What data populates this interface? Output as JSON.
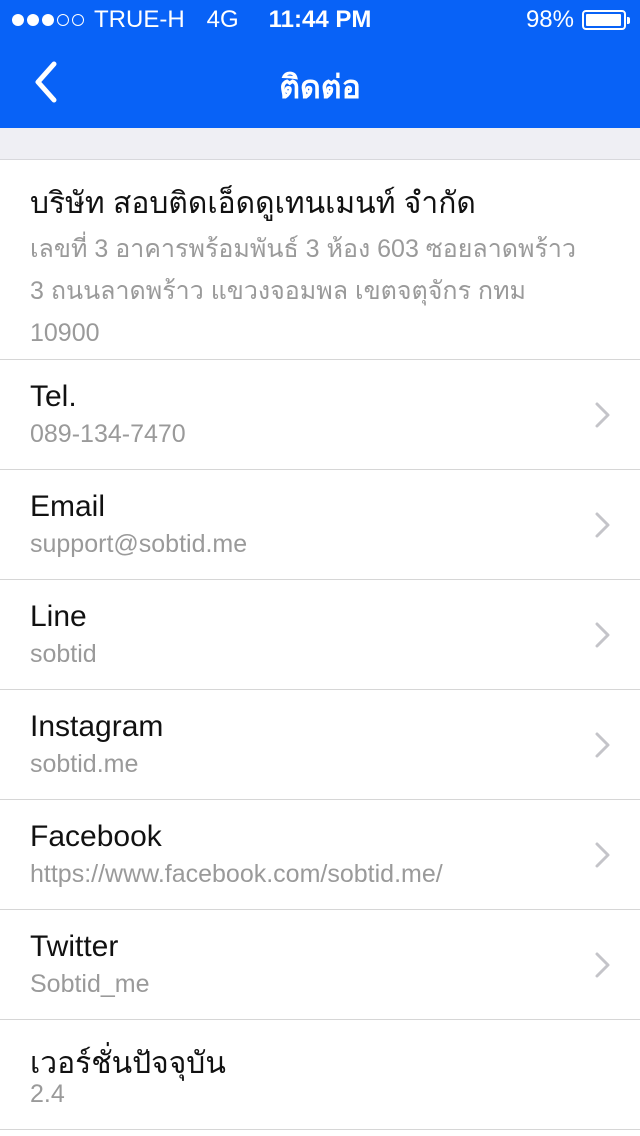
{
  "status_bar": {
    "carrier": "TRUE-H",
    "network": "4G",
    "time": "11:44 PM",
    "battery_text": "98%",
    "battery_level": 0.98,
    "signal_bars_filled": 3,
    "signal_bars_total": 5
  },
  "nav": {
    "title": "ติดต่อ",
    "back_icon": "chevron-left-icon",
    "bar_color": "#0862f7"
  },
  "company": {
    "name": "บริษัท สอบติดเอ็ดดูเทนเมนท์ จำกัด",
    "address": "เลขที่ 3 อาคารพร้อมพันธ์ 3 ห้อง 603 ซอยลาดพร้าว 3 ถนนลาดพร้าว แขวงจอมพล เขตจตุจักร กทม 10900"
  },
  "contacts": [
    {
      "label": "Tel.",
      "value": "089-134-7470",
      "icon": "chevron-right-icon"
    },
    {
      "label": "Email",
      "value": "support@sobtid.me",
      "icon": "chevron-right-icon"
    },
    {
      "label": "Line",
      "value": "sobtid",
      "icon": "chevron-right-icon"
    },
    {
      "label": "Instagram",
      "value": "sobtid.me",
      "icon": "chevron-right-icon"
    },
    {
      "label": "Facebook",
      "value": "https://www.facebook.com/sobtid.me/",
      "icon": "chevron-right-icon"
    },
    {
      "label": "Twitter",
      "value": "Sobtid_me",
      "icon": "chevron-right-icon"
    }
  ],
  "version": {
    "label": "เวอร์ชั่นปัจจุบัน",
    "value": "2.4"
  }
}
